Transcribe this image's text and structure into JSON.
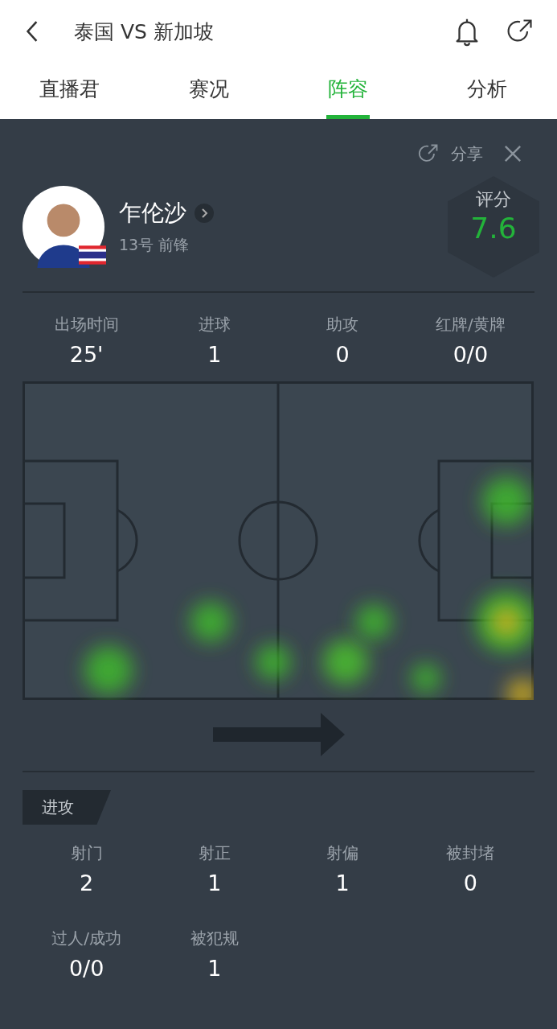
{
  "header": {
    "title": "泰国 VS 新加坡"
  },
  "tabs": [
    {
      "label": "直播君",
      "selected": false
    },
    {
      "label": "赛况",
      "selected": false
    },
    {
      "label": "阵容",
      "selected": true
    },
    {
      "label": "分析",
      "selected": false
    }
  ],
  "card": {
    "share": "分享"
  },
  "player": {
    "name": "乍伦沙",
    "number_position": "13号 前锋",
    "rating_label": "评分",
    "rating": "7.6"
  },
  "summary": [
    {
      "label": "出场时间",
      "value": "25'"
    },
    {
      "label": "进球",
      "value": "1"
    },
    {
      "label": "助攻",
      "value": "0"
    },
    {
      "label": "红牌/黄牌",
      "value": "0/0"
    }
  ],
  "section": {
    "title": "进攻"
  },
  "attack": [
    {
      "label": "射门",
      "value": "2"
    },
    {
      "label": "射正",
      "value": "1"
    },
    {
      "label": "射偏",
      "value": "1"
    },
    {
      "label": "被封堵",
      "value": "0"
    },
    {
      "label": "过人/成功",
      "value": "0/0"
    },
    {
      "label": "被犯规",
      "value": "1"
    }
  ]
}
